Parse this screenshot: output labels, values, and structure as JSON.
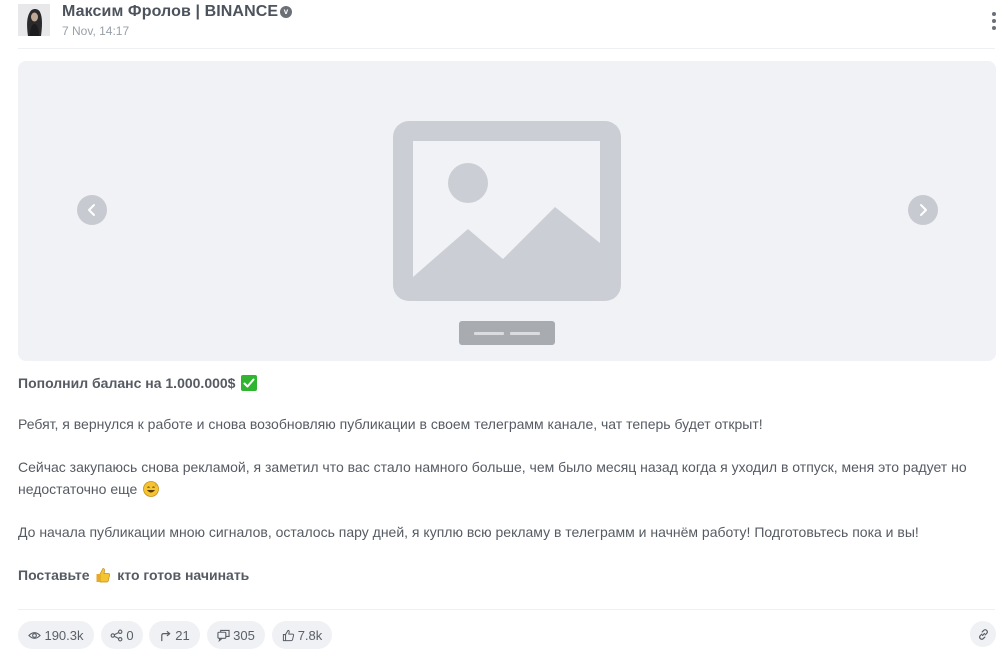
{
  "channel": {
    "name": "Максим Фролов | BINANCE",
    "date": "7 Nov, 14:17",
    "verified_mark": "v"
  },
  "icons": {
    "avatar": "avatar",
    "verified": "verified-badge-icon",
    "menu": "more-vertical-icon",
    "prev": "chevron-left-icon",
    "next": "chevron-right-icon",
    "image": "image-placeholder-icon",
    "views": "eye-icon",
    "shares": "share-icon",
    "forwards": "forward-icon",
    "comments": "comments-icon",
    "reactions": "thumbs-up-icon",
    "link": "link-icon"
  },
  "post": {
    "title": "Пополнил баланс на 1.000.000$",
    "paragraph1": "Ребят, я вернулся к работе и снова возобновляю публикации в своем телеграмм канале, чат теперь будет открыт!",
    "paragraph2": "Сейчас закупаюсь снова рекламой, я заметил что вас стало намного больше, чем было месяц назад когда я уходил в отпуск, меня это радует но недостаточно еще",
    "paragraph3": "До начала публикации мною сигналов, осталось пару дней, я куплю всю рекламу в телеграмм и начнём работу! Подготовьтесь пока и вы!",
    "cta_before": "Поставьте",
    "cta_after": "кто готов начинать"
  },
  "stats": {
    "views": "190.3k",
    "shares": "0",
    "forwards": "21",
    "comments": "305",
    "reactions": "7.8k"
  },
  "colors": {
    "placeholder": "#cbced4",
    "media_bg": "#f0f2f6",
    "chip_bg": "#eff1f4",
    "check_green": "#2fb52f"
  }
}
